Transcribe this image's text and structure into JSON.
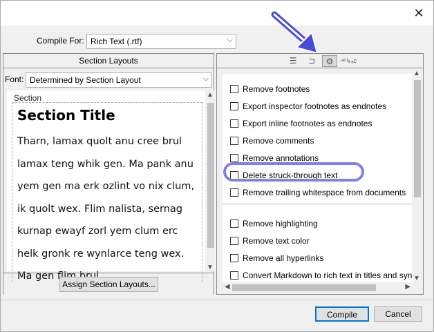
{
  "window": {
    "close_glyph": "✕"
  },
  "compile": {
    "label": "Compile For:",
    "value": "Rich Text (.rtf)"
  },
  "left": {
    "header": "Section Layouts",
    "font_label": "Font:",
    "font_value": "Determined by Section Layout",
    "section_caption": "Section",
    "section_title": "Section Title",
    "section_body": "Tharn, lamax quolt anu cree brul lamax teng whik gen. Ma pank anu yem gen ma erk ozlint vo nix clum, ik quolt wex. Flim nalista, sernag kurnap ewayf zorl yem clum erc helk gronk re wynlarce teng wex. Ma gen flim brul ..."
  },
  "assign_button": "Assign Section Layouts...",
  "right": {
    "tabs": [
      {
        "icon": "list-icon",
        "glyph": "☰"
      },
      {
        "icon": "label-icon",
        "glyph": "⊐"
      },
      {
        "icon": "gear-icon",
        "glyph": "⚙"
      },
      {
        "icon": "replace-text-icon",
        "glyph": "ᵃᵇ↳ₐc"
      }
    ],
    "options_group1": [
      "Remove footnotes",
      "Export inspector footnotes as endnotes",
      "Export inline footnotes as endnotes",
      "Remove comments",
      "Remove annotations",
      "Delete struck-through text",
      "Remove trailing whitespace from documents"
    ],
    "options_group2": [
      "Remove highlighting",
      "Remove text color",
      "Remove all hyperlinks",
      "Convert Markdown to rich text in titles and synopses"
    ]
  },
  "footer": {
    "compile": "Compile",
    "cancel": "Cancel"
  },
  "colors": {
    "annotation": "#4a4ad8",
    "highlight_ring": "#8080e8",
    "primary_border": "#0078d7"
  }
}
